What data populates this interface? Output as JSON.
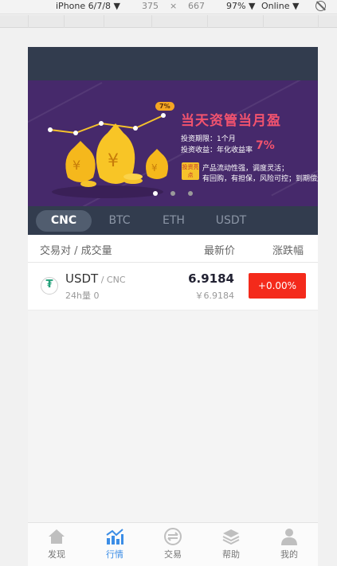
{
  "devtools": {
    "device": "iPhone 6/7/8 ▼",
    "width": "375",
    "times": "×",
    "height": "667",
    "zoom": "97% ▼",
    "network": "Online ▼"
  },
  "banner": {
    "badge": "7%",
    "title": "当天资管当月盈",
    "line1": "投资期限：1个月",
    "line2": "投资收益：年化收益率",
    "rate": "7%",
    "tag": "投资亮点",
    "line3": "产品流动性强，调度灵活；",
    "line4": "有回购，有担保，风险可控；到期偿还",
    "active_dot": 1
  },
  "market_tabs": [
    {
      "label": "CNC",
      "active": true
    },
    {
      "label": "BTC",
      "active": false
    },
    {
      "label": "ETH",
      "active": false
    },
    {
      "label": "USDT",
      "active": false
    }
  ],
  "table": {
    "col_pair": "交易对 / 成交量",
    "col_price": "最新价",
    "col_change": "涨跌幅",
    "rows": [
      {
        "icon": "tether-icon",
        "coin": "USDT",
        "quote": " / CNC",
        "volume": "24h量 0",
        "price": "6.9184",
        "cny": "￥6.9184",
        "change": "+0.00%",
        "change_color": "#f42a1b"
      }
    ]
  },
  "tabbar": [
    {
      "label": "发现",
      "icon": "home-icon",
      "active": false
    },
    {
      "label": "行情",
      "icon": "chart-icon",
      "active": true
    },
    {
      "label": "交易",
      "icon": "exchange-icon",
      "active": false
    },
    {
      "label": "帮助",
      "icon": "layers-icon",
      "active": false
    },
    {
      "label": "我的",
      "icon": "user-icon",
      "active": false
    }
  ],
  "colors": {
    "header_bg": "#323c4e",
    "banner_bg": "#46296b",
    "accent": "#3b8de6",
    "down_red": "#f42a1b"
  }
}
